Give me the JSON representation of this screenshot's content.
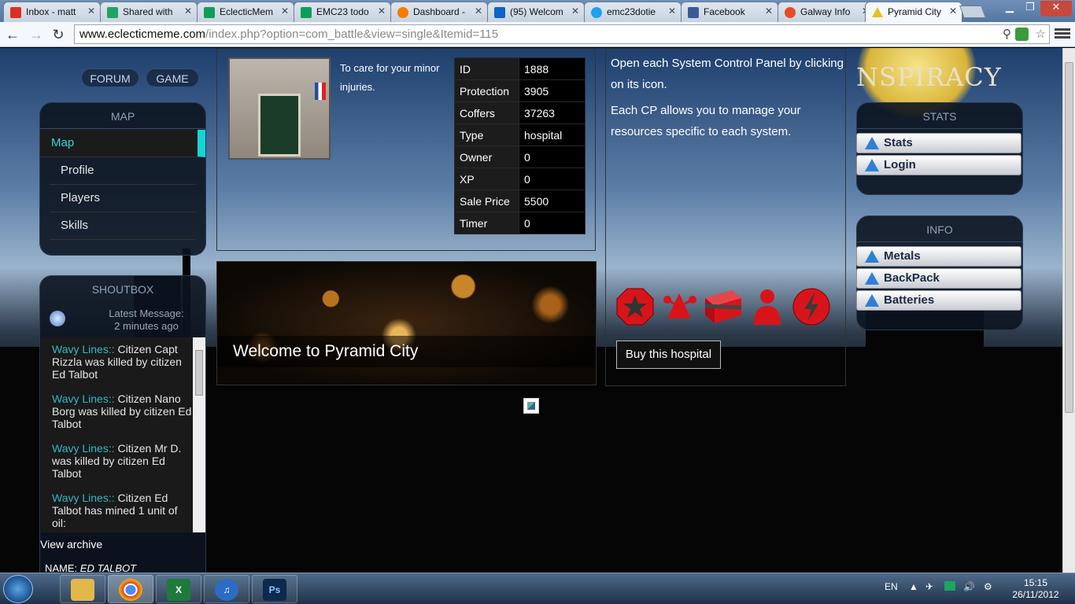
{
  "browser": {
    "tabs": [
      {
        "label": "Inbox - matt",
        "icon": "gmail-icon",
        "color": "#d93025"
      },
      {
        "label": "Shared with",
        "icon": "google-drive-icon",
        "color": "#1fa463"
      },
      {
        "label": "EclecticMem",
        "icon": "spreadsheet-icon",
        "color": "#0f9d58"
      },
      {
        "label": "EMC23 todo",
        "icon": "spreadsheet-icon",
        "color": "#0f9d58"
      },
      {
        "label": "Dashboard -",
        "icon": "blogger-icon",
        "color": "#f57d00"
      },
      {
        "label": "(95) Welcom",
        "icon": "linkedin-icon",
        "color": "#0a66c2"
      },
      {
        "label": "emc23dotie",
        "icon": "twitter-icon",
        "color": "#1da1f2"
      },
      {
        "label": "Facebook",
        "icon": "facebook-icon",
        "color": "#3b5998"
      },
      {
        "label": "Galway Info",
        "icon": "joomla-icon",
        "color": "#e44d26"
      },
      {
        "label": "Pyramid City",
        "icon": "pyramid-icon",
        "color": "#e8c020"
      }
    ],
    "url_host": "www.eclecticmeme.com",
    "url_path": "/index.php?option=com_battle&view=single&Itemid=115"
  },
  "top_nav": {
    "forum": "FORUM",
    "game": "GAME"
  },
  "map_panel": {
    "title": "MAP",
    "items": [
      {
        "label": "Map"
      },
      {
        "label": "Profile"
      },
      {
        "label": "Players"
      },
      {
        "label": "Skills"
      }
    ]
  },
  "shoutbox": {
    "title": "SHOUTBOX",
    "latest": "Latest Message:",
    "time": "2 minutes ago",
    "messages": [
      {
        "tag": "Wavy Lines::",
        "text": " Citizen Capt Rizzla was killed by citizen Ed Talbot"
      },
      {
        "tag": "Wavy Lines::",
        "text": " Citizen Nano Borg was killed by citizen Ed Talbot"
      },
      {
        "tag": "Wavy Lines::",
        "text": " Citizen Mr D. was killed by citizen Ed Talbot"
      },
      {
        "tag": "Wavy Lines::",
        "text": " Citizen Ed Talbot has mined 1 unit of oil:"
      }
    ],
    "archive": "View archive",
    "name_label": "NAME:",
    "name_value": "ED TALBOT"
  },
  "building": {
    "description": "To care for your minor injuries.",
    "stats": [
      {
        "key": "ID",
        "value": "1888"
      },
      {
        "key": "Protection",
        "value": "3905"
      },
      {
        "key": "Coffers",
        "value": "37263"
      },
      {
        "key": "Type",
        "value": "hospital"
      },
      {
        "key": "Owner",
        "value": "0"
      },
      {
        "key": "XP",
        "value": "0"
      },
      {
        "key": "Sale Price",
        "value": "5500"
      },
      {
        "key": "Timer",
        "value": "0"
      }
    ]
  },
  "banner": {
    "caption": "Welcome to Pyramid City"
  },
  "control_panel": {
    "p1": "Open each System Control Panel by clicking on its icon.",
    "p2": "Each CP allows you to manage your resources specific to each system.",
    "icons": [
      "octagon-star-icon",
      "molecule-icon",
      "box-icon",
      "person-icon",
      "lightning-icon"
    ],
    "buy_label": "Buy this hospital"
  },
  "right_col": {
    "logo": "NSPIRACY",
    "stats_title": "STATS",
    "stats_items": [
      {
        "label": "Stats"
      },
      {
        "label": "Login"
      }
    ],
    "info_title": "INFO",
    "info_items": [
      {
        "label": "Metals"
      },
      {
        "label": "BackPack"
      },
      {
        "label": "Batteries"
      }
    ]
  },
  "taskbar": {
    "apps": [
      {
        "name": "explorer",
        "icon": "folder-icon",
        "color": "#e3b84a",
        "glyph": ""
      },
      {
        "name": "chrome",
        "icon": "chrome-icon",
        "color": "#db4437",
        "glyph": ""
      },
      {
        "name": "excel",
        "icon": "excel-icon",
        "color": "#1d7a3a",
        "glyph": "X"
      },
      {
        "name": "itunes",
        "icon": "itunes-icon",
        "color": "#2c6cc5",
        "glyph": "♫"
      },
      {
        "name": "photoshop",
        "icon": "photoshop-icon",
        "color": "#0b2a4e",
        "glyph": "Ps"
      }
    ],
    "lang": "EN",
    "time": "15:15",
    "date": "26/11/2012"
  },
  "colors": {
    "accent": "#16d3d8",
    "link": "#34b8c4",
    "cp_red": "#d8141b"
  }
}
